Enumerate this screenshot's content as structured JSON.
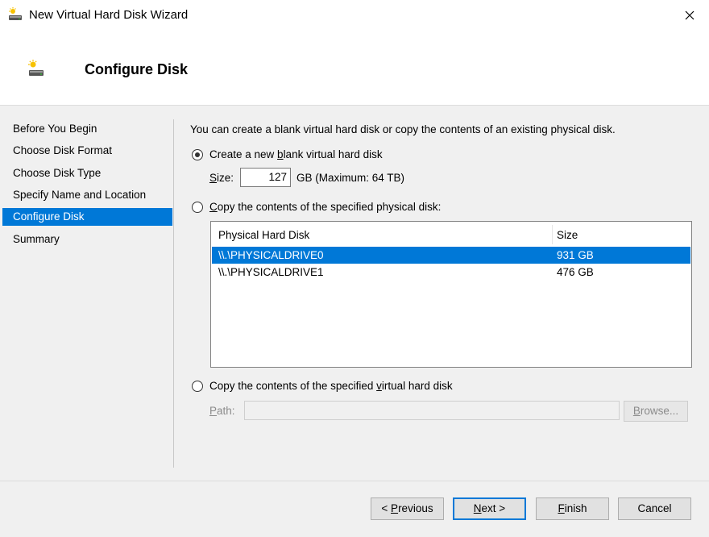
{
  "window": {
    "title": "New Virtual Hard Disk Wizard",
    "icons": {
      "app": "virtual-disk-icon",
      "close": "close-icon"
    }
  },
  "header": {
    "title": "Configure Disk"
  },
  "nav": {
    "items": [
      {
        "label": "Before You Begin",
        "selected": false
      },
      {
        "label": "Choose Disk Format",
        "selected": false
      },
      {
        "label": "Choose Disk Type",
        "selected": false
      },
      {
        "label": "Specify Name and Location",
        "selected": false
      },
      {
        "label": "Configure Disk",
        "selected": true
      },
      {
        "label": "Summary",
        "selected": false
      }
    ]
  },
  "content": {
    "intro": "You can create a blank virtual hard disk or copy the contents of an existing physical disk.",
    "option_new": {
      "pre": "Create a new ",
      "accel": "b",
      "post": "lank virtual hard disk",
      "checked": true
    },
    "size": {
      "label_accel": "S",
      "label_rest": "ize:",
      "value": "127",
      "suffix": "GB (Maximum: 64 TB)"
    },
    "option_physical": {
      "pre": "",
      "accel": "C",
      "post": "opy the contents of the specified physical disk:",
      "checked": false
    },
    "physical_disks": {
      "columns": [
        "Physical Hard Disk",
        "Size"
      ],
      "rows": [
        {
          "name": "\\\\.\\PHYSICALDRIVE0",
          "size": "931 GB",
          "selected": true
        },
        {
          "name": "\\\\.\\PHYSICALDRIVE1",
          "size": "476 GB",
          "selected": false
        }
      ]
    },
    "option_virtual": {
      "pre": "Copy the contents of the specified ",
      "accel": "v",
      "post": "irtual hard disk",
      "checked": false
    },
    "path": {
      "label_accel": "P",
      "label_rest": "ath:",
      "value": "",
      "browse_accel": "B",
      "browse_rest": "rowse..."
    }
  },
  "footer": {
    "previous": {
      "pre": "< ",
      "accel": "P",
      "post": "revious"
    },
    "next": {
      "pre": "",
      "accel": "N",
      "post": "ext >"
    },
    "finish": {
      "pre": "",
      "accel": "F",
      "post": "inish"
    },
    "cancel": "Cancel"
  },
  "colors": {
    "accent": "#0078d7",
    "background": "#f0f0f0",
    "header_bg": "#ffffff"
  }
}
